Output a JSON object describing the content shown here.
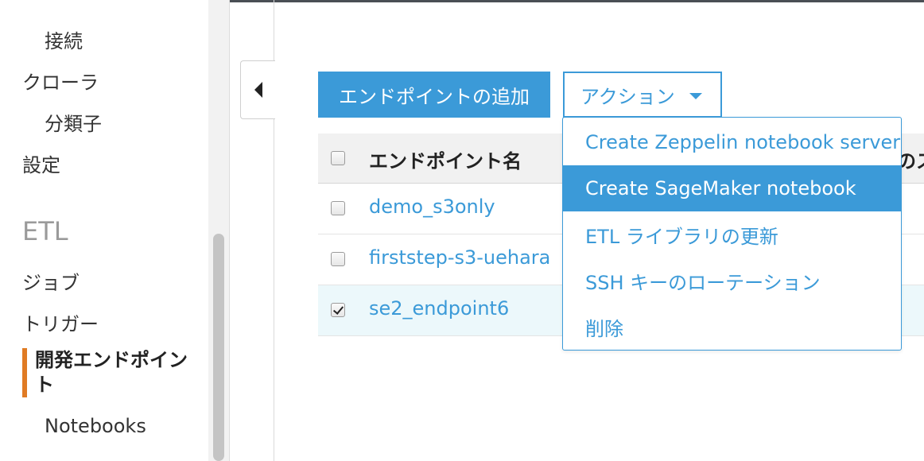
{
  "sidebar": {
    "items": [
      {
        "label": "接続",
        "level": "sub"
      },
      {
        "label": "クローラ",
        "level": "top"
      },
      {
        "label": "分類子",
        "level": "sub"
      },
      {
        "label": "設定",
        "level": "top"
      }
    ],
    "etl_heading": "ETL",
    "etl_items": [
      {
        "label": "ジョブ"
      },
      {
        "label": "トリガー"
      }
    ],
    "active_item": "開発エンドポイント",
    "notebooks": "Notebooks",
    "active_color": "#e07b24"
  },
  "toolbar": {
    "add_endpoint_label": "エンドポイントの追加",
    "action_label": "アクション",
    "accent_color": "#3b9ad8"
  },
  "table": {
    "header_name": "エンドポイント名",
    "header_partial": "のス",
    "rows": [
      {
        "name": "demo_s3only",
        "checked": false
      },
      {
        "name": "firststep-s3-uehara",
        "checked": false
      },
      {
        "name": "se2_endpoint6",
        "checked": true
      }
    ]
  },
  "action_menu": {
    "items": [
      {
        "label": "Create Zeppelin notebook server"
      },
      {
        "label": "Create SageMaker notebook",
        "highlighted": true
      },
      {
        "label": "ETL ライブラリの更新"
      },
      {
        "label": "SSH キーのローテーション"
      },
      {
        "label": "削除"
      }
    ]
  },
  "icons": {
    "collapse": "caret-left-icon",
    "dropdown": "caret-down-icon",
    "checkbox": "checkbox-icon"
  }
}
